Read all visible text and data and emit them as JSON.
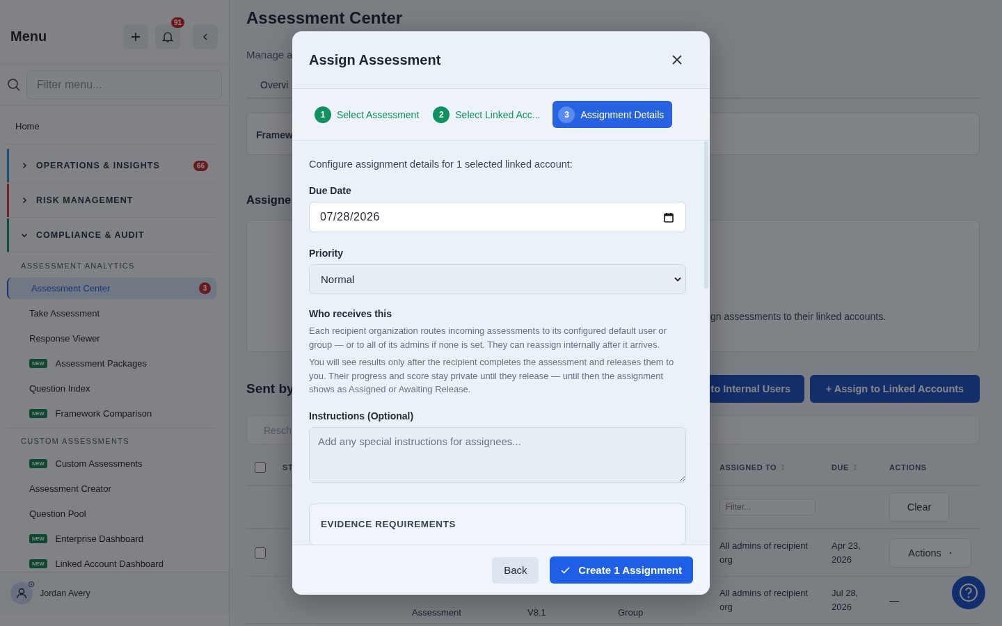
{
  "sidebar": {
    "title": "Menu",
    "notification_count": "91",
    "filter_placeholder": "Filter menu...",
    "items": [
      {
        "kind": "link",
        "label": "Home",
        "selected": false
      },
      {
        "kind": "section",
        "label": "OPERATIONS & INSIGHTS",
        "expanded": false,
        "color": "#1c4f72",
        "badge": "66"
      },
      {
        "kind": "section",
        "label": "RISK MANAGEMENT",
        "expanded": false,
        "color": "#6d1e21"
      },
      {
        "kind": "section",
        "label": "COMPLIANCE & AUDIT",
        "expanded": true,
        "color": "#104b37"
      },
      {
        "kind": "group",
        "label": "ASSESSMENT ANALYTICS"
      },
      {
        "kind": "item",
        "label": "Assessment Center",
        "selected": true,
        "badge": "3"
      },
      {
        "kind": "item",
        "label": "Take Assessment",
        "selected": false
      },
      {
        "kind": "item",
        "label": "Response Viewer",
        "selected": false
      },
      {
        "kind": "item",
        "label": "Assessment Packages",
        "selected": false,
        "tag": "NEW"
      },
      {
        "kind": "item",
        "label": "Question Index",
        "selected": false
      },
      {
        "kind": "item",
        "label": "Framework Comparison",
        "selected": false,
        "tag": "NEW"
      },
      {
        "kind": "group",
        "label": "CUSTOM ASSESSMENTS"
      },
      {
        "kind": "item",
        "label": "Custom Assessments",
        "selected": false,
        "tag": "NEW"
      },
      {
        "kind": "item",
        "label": "Assessment Creator",
        "selected": false
      },
      {
        "kind": "item",
        "label": "Question Pool",
        "selected": false
      },
      {
        "kind": "item",
        "label": "Enterprise Dashboard",
        "selected": false,
        "tag": "NEW"
      },
      {
        "kind": "item",
        "label": "Linked Account Dashboard",
        "selected": false,
        "tag": "NEW"
      }
    ],
    "user": {
      "name": "Jordan Avery"
    }
  },
  "page": {
    "title": "Assessment Center",
    "subtitle": "Manage a",
    "tab": "Overvi",
    "filter_label": "Framew",
    "assigned_heading": "Assigne",
    "assigned_text": "gn assessments to their linked accounts.",
    "sent_heading": "Sent by",
    "buttons": [
      "to Internal Users",
      "+ Assign to Linked Accounts"
    ],
    "toolbar_text": "Resch",
    "table": {
      "header_checked": false,
      "columns": [
        {
          "label": "ST",
          "sortable": false
        },
        {
          "label": "ASSIGNED TO",
          "sortable": true
        },
        {
          "label": "DUE",
          "sortable": true
        },
        {
          "label": "ACTIONS",
          "sortable": false
        }
      ],
      "filter_placeholder": "Filter...",
      "clear": "Clear",
      "rows": [
        {
          "checked": false,
          "assigned_to": "All admins of recipient org",
          "due": "Apr 23, 2026",
          "action": "Actions"
        },
        {
          "assessment": "Assessment",
          "version": "V8.1",
          "group": "Group",
          "assigned_to": "All admins of recipient org",
          "due": "Jul 28, 2026",
          "action": "—"
        }
      ]
    }
  },
  "modal": {
    "title": "Assign Assessment",
    "steps": [
      {
        "number": "1",
        "label": "Select Assessment",
        "completed": true,
        "selected": false
      },
      {
        "number": "2",
        "label": "Select Linked Acc...",
        "completed": true,
        "selected": false
      },
      {
        "number": "3",
        "label": "Assignment Details",
        "completed": false,
        "selected": true
      }
    ],
    "intro": "Configure assignment details for 1 selected linked account:",
    "due_label": "Due Date",
    "due_value": "07/28/2026",
    "priority_label": "Priority",
    "priority_value": "Normal",
    "who_heading": "Who receives this",
    "paragraphs": [
      "Each recipient organization routes incoming assessments to its configured default user or group — or to all of its admins if none is set. They can reassign internally after it arrives.",
      "You will see results only after the recipient completes the assessment and releases them to you. Their progress and score stay private until they release — until then the assignment shows as Assigned or Awaiting Release."
    ],
    "instructions_label": "Instructions (Optional)",
    "instructions_placeholder": "Add any special instructions for assignees...",
    "evidence_heading": "EVIDENCE REQUIREMENTS",
    "back": "Back",
    "create": "Create 1 Assignment"
  }
}
